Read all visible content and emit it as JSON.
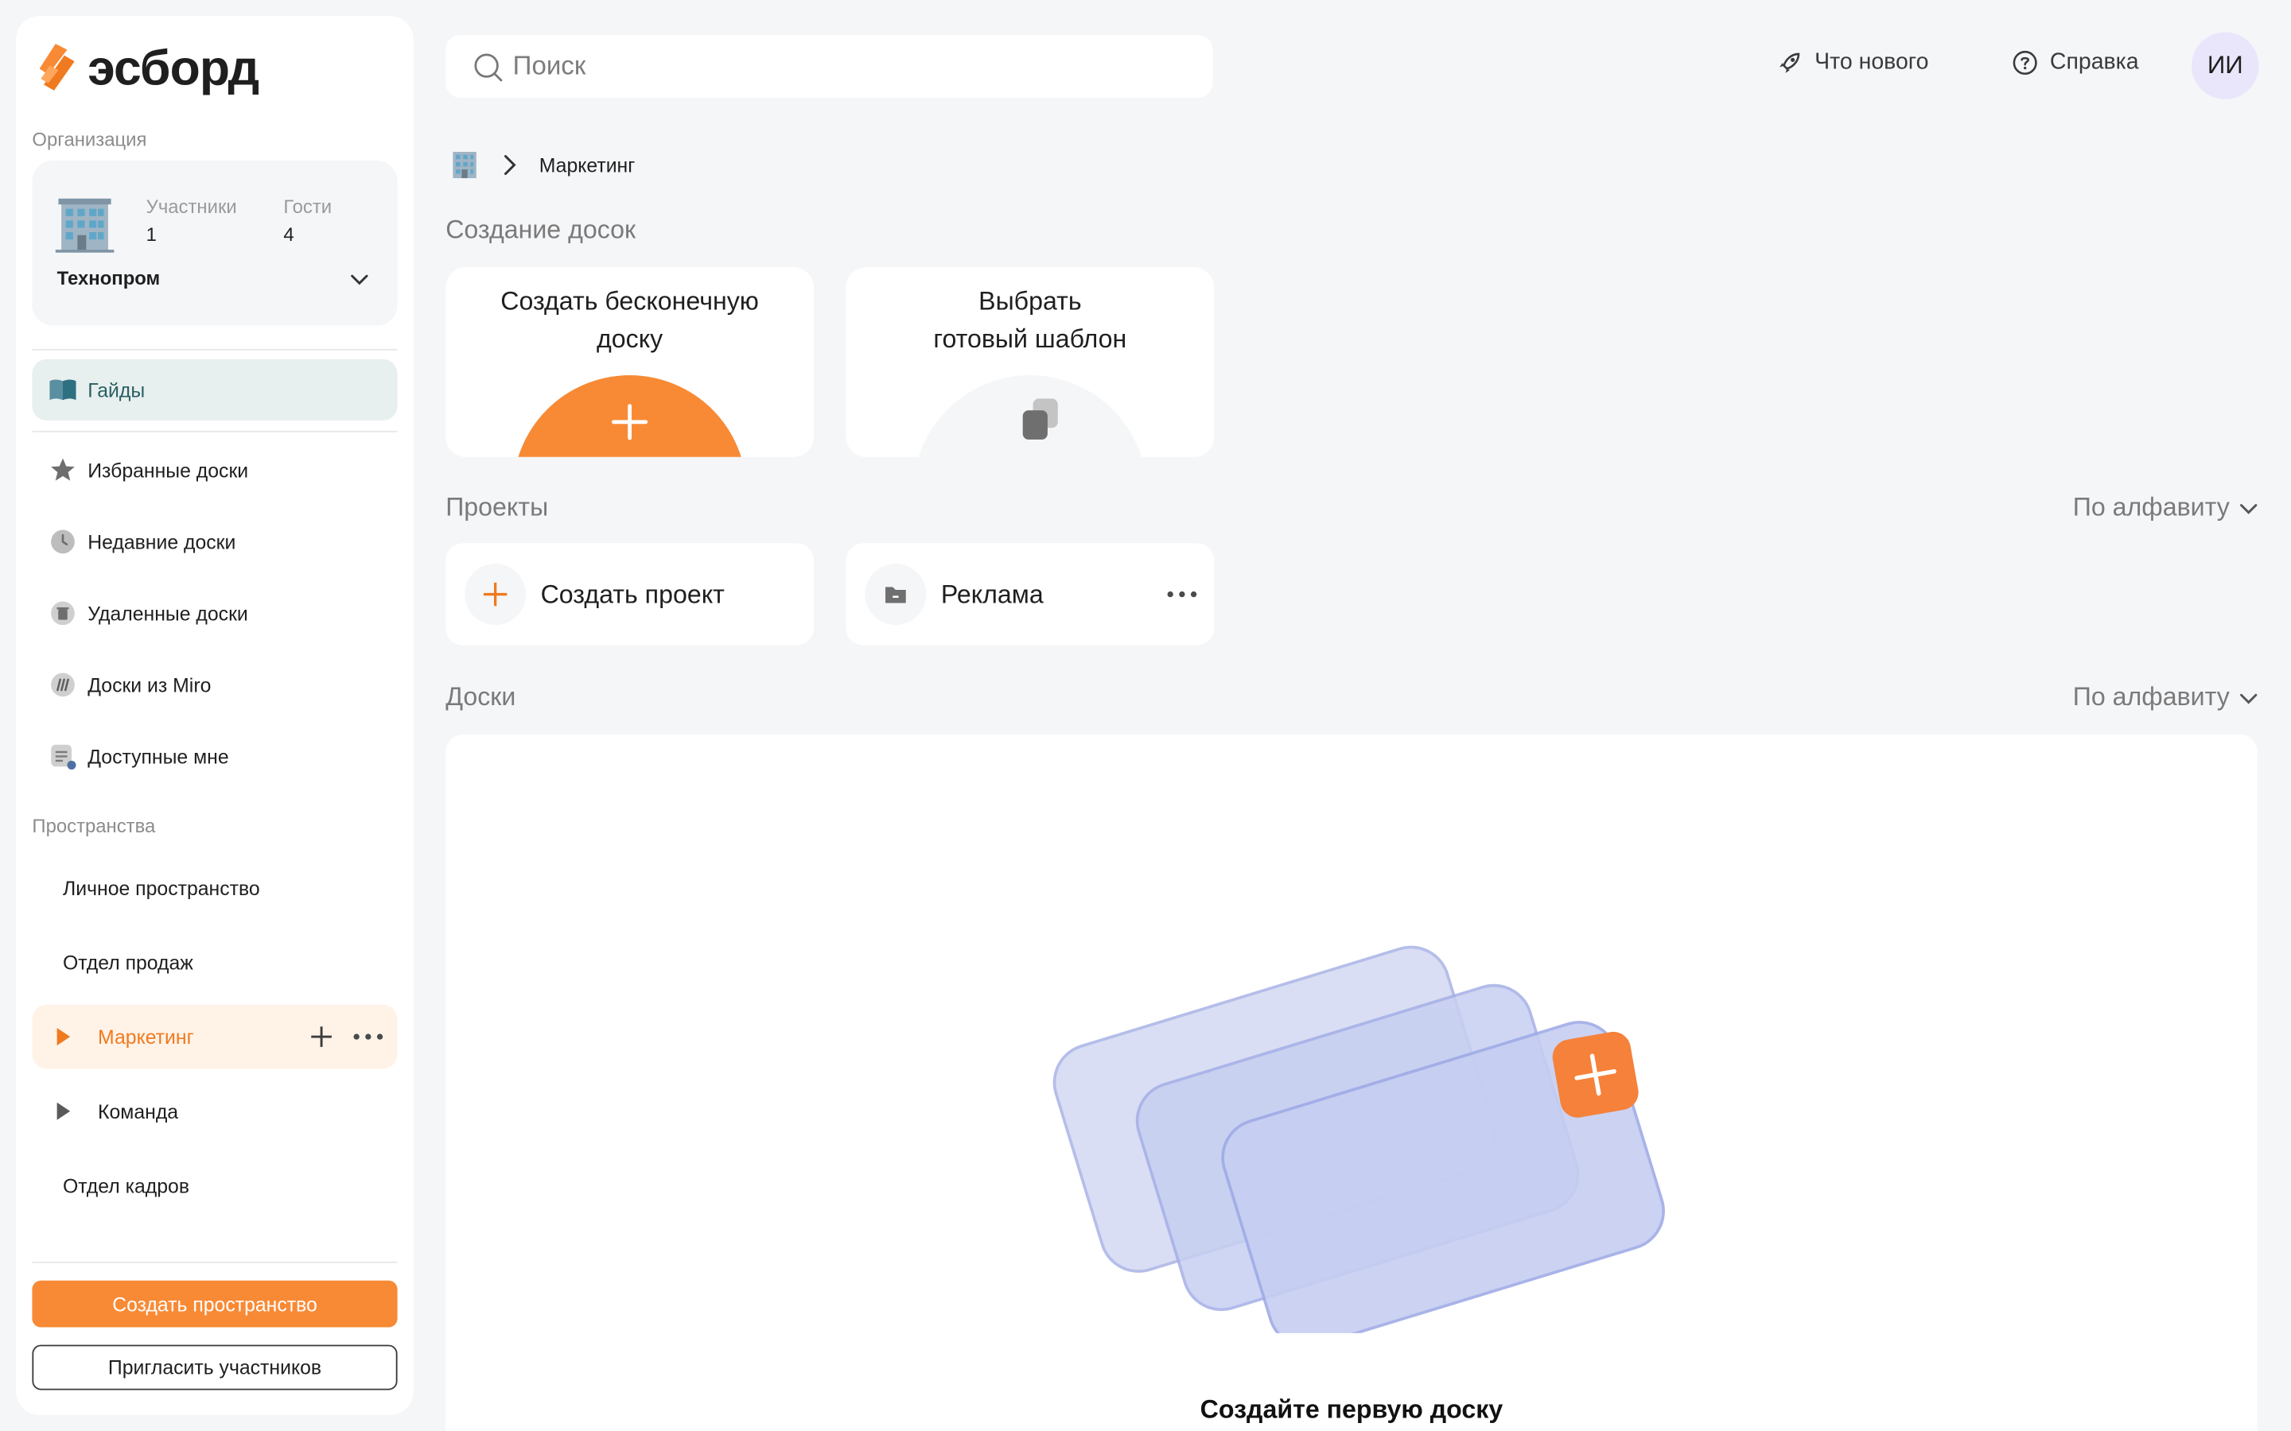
{
  "app": {
    "logo_text": "эсборд",
    "brand_color": "#f88a35"
  },
  "sidebar": {
    "org_section_label": "Организация",
    "org": {
      "name": "Технопром",
      "members_label": "Участники",
      "members_count": "1",
      "guests_label": "Гости",
      "guests_count": "4"
    },
    "guides_label": "Гайды",
    "nav": [
      {
        "label": "Избранные доски",
        "icon": "star-icon"
      },
      {
        "label": "Недавние доски",
        "icon": "clock-icon"
      },
      {
        "label": "Удаленные доски",
        "icon": "trash-icon"
      },
      {
        "label": "Доски из Miro",
        "icon": "miro-icon"
      },
      {
        "label": "Доступные мне",
        "icon": "shared-doc-icon"
      }
    ],
    "spaces_section_label": "Пространства",
    "spaces": [
      {
        "label": "Личное пространство",
        "expandable": false,
        "selected": false
      },
      {
        "label": "Отдел продаж",
        "expandable": false,
        "selected": false
      },
      {
        "label": "Маркетинг",
        "expandable": true,
        "selected": true
      },
      {
        "label": "Команда",
        "expandable": true,
        "selected": false
      },
      {
        "label": "Отдел кадров",
        "expandable": false,
        "selected": false
      }
    ],
    "create_space_label": "Создать пространство",
    "invite_label": "Пригласить участников"
  },
  "header": {
    "search_placeholder": "Поиск",
    "whats_new_label": "Что нового",
    "help_label": "Справка",
    "avatar_initials": "ИИ"
  },
  "breadcrumb": {
    "current": "Маркетинг"
  },
  "create_section": {
    "title": "Создание досок",
    "infinite_board_label": "Создать бесконечную доску",
    "template_label_line1": "Выбрать",
    "template_label_line2": "готовый шаблон"
  },
  "projects_section": {
    "title": "Проекты",
    "sort_label": "По алфавиту",
    "create_project_label": "Создать проект",
    "projects": [
      {
        "label": "Реклама"
      }
    ]
  },
  "boards_section": {
    "title": "Доски",
    "sort_label": "По алфавиту",
    "empty_title": "Создайте первую доску"
  }
}
